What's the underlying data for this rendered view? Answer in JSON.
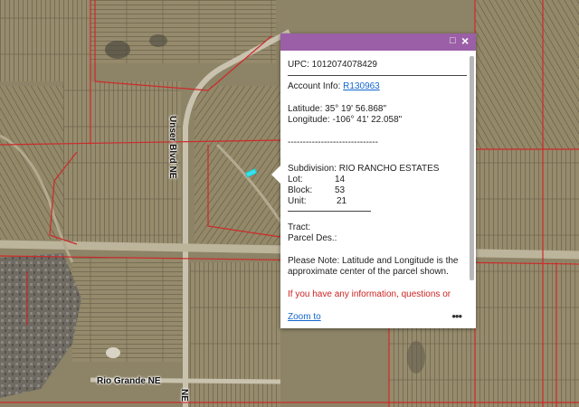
{
  "map": {
    "road_labels": {
      "vertical_road": "Unser Blvd NE",
      "horizontal_road": "Rio Grande NE",
      "lower_road": "NE"
    },
    "colors": {
      "parcel_boundary": "#cc2a2a",
      "selected_parcel": "#35e3ea",
      "terrain": "#8d8366"
    }
  },
  "popup": {
    "header_color": "#9b5fa7",
    "upc_line": "UPC: 1012074078429",
    "account_label": "Account Info: ",
    "account_link": "R130963",
    "latitude_line": "Latitude: 35° 19' 56.868\"",
    "longitude_line": "Longitude: -106° 41' 22.058\"",
    "separator_1": "------------------------------",
    "subdivision_line": "Subdivision: RIO RANCHO ESTATES",
    "lot_label": "Lot:",
    "lot_value": "14",
    "block_label": "Block:",
    "block_value": "53",
    "unit_label": "Unit:",
    "unit_value": "21",
    "tract_line": "Tract:",
    "parcel_des_line": "Parcel Des.:",
    "note_line_1": "Please Note: Latitude and Longitude is the",
    "note_line_2": "approximate center of the parcel shown.",
    "red_line_1": "If you have any information, questions or",
    "zoom_to": "Zoom to",
    "more": "•••"
  }
}
